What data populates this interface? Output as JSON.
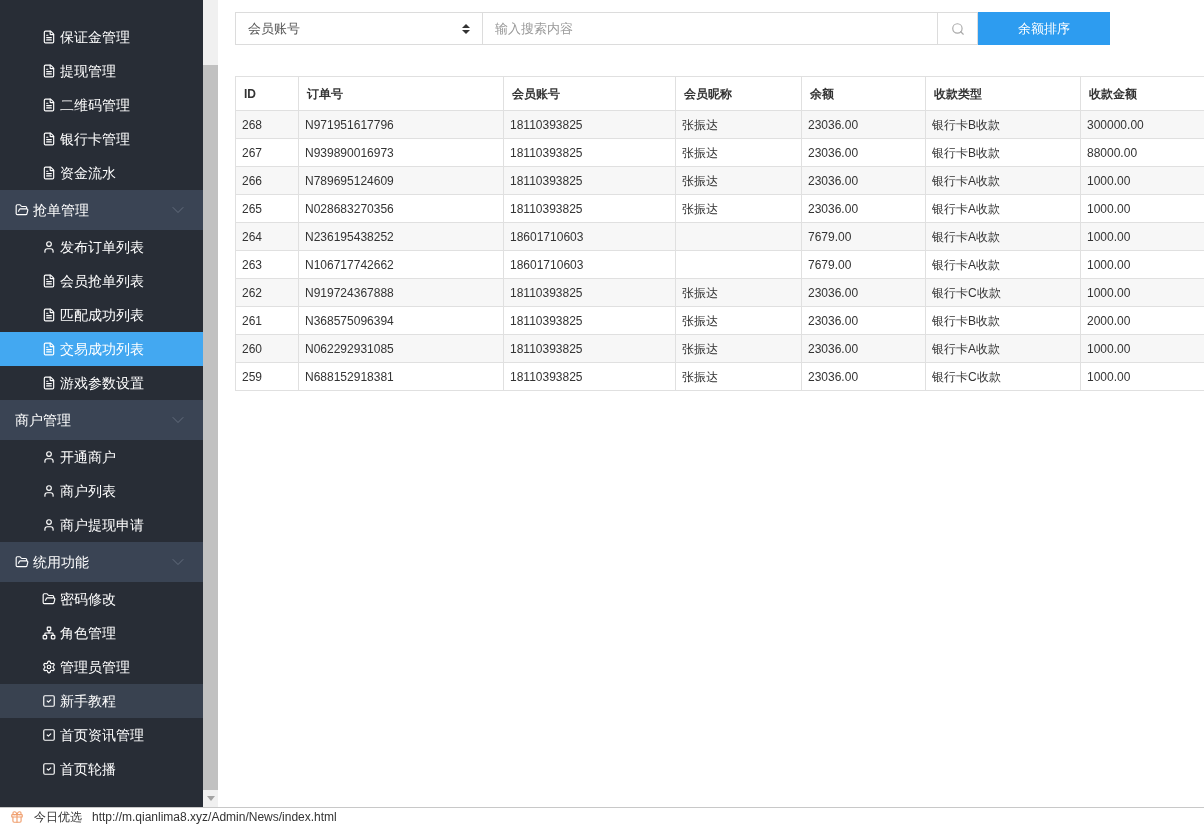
{
  "sidebar": {
    "sections": [
      {
        "items": [
          {
            "label": "保证金管理",
            "selected": false,
            "highlighted": false
          },
          {
            "label": "提现管理",
            "selected": false,
            "highlighted": false
          },
          {
            "label": "二维码管理",
            "selected": false,
            "highlighted": false
          },
          {
            "label": "银行卡管理",
            "selected": false,
            "highlighted": false
          },
          {
            "label": "资金流水",
            "selected": false,
            "highlighted": false
          }
        ]
      },
      {
        "title": "抢单管理",
        "items": [
          {
            "label": "发布订单列表",
            "selected": false,
            "highlighted": false
          },
          {
            "label": "会员抢单列表",
            "selected": false,
            "highlighted": false
          },
          {
            "label": "匹配成功列表",
            "selected": false,
            "highlighted": false
          },
          {
            "label": "交易成功列表",
            "selected": true,
            "highlighted": false
          },
          {
            "label": "游戏参数设置",
            "selected": false,
            "highlighted": false
          }
        ]
      },
      {
        "title": "商户管理",
        "items": [
          {
            "label": "开通商户",
            "selected": false,
            "highlighted": false
          },
          {
            "label": "商户列表",
            "selected": false,
            "highlighted": false
          },
          {
            "label": "商户提现申请",
            "selected": false,
            "highlighted": false
          }
        ]
      },
      {
        "title": "统用功能",
        "items": [
          {
            "label": "密码修改",
            "selected": false,
            "highlighted": false
          },
          {
            "label": "角色管理",
            "selected": false,
            "highlighted": false
          },
          {
            "label": "管理员管理",
            "selected": false,
            "highlighted": false
          },
          {
            "label": "新手教程",
            "selected": false,
            "highlighted": true
          },
          {
            "label": "首页资讯管理",
            "selected": false,
            "highlighted": false
          },
          {
            "label": "首页轮播",
            "selected": false,
            "highlighted": false
          }
        ]
      }
    ]
  },
  "search": {
    "field_select": "会员账号",
    "placeholder": "输入搜索内容",
    "sort_button": "余额排序"
  },
  "table": {
    "columns": [
      "ID",
      "订单号",
      "会员账号",
      "会员昵称",
      "余额",
      "收款类型",
      "收款金额"
    ],
    "rows": [
      [
        "268",
        "N971951617796",
        "18110393825",
        "张振达",
        "23036.00",
        "银行卡B收款",
        "300000.00"
      ],
      [
        "267",
        "N939890016973",
        "18110393825",
        "张振达",
        "23036.00",
        "银行卡B收款",
        "88000.00"
      ],
      [
        "266",
        "N789695124609",
        "18110393825",
        "张振达",
        "23036.00",
        "银行卡A收款",
        "1000.00"
      ],
      [
        "265",
        "N028683270356",
        "18110393825",
        "张振达",
        "23036.00",
        "银行卡A收款",
        "1000.00"
      ],
      [
        "264",
        "N236195438252",
        "18601710603",
        "",
        "7679.00",
        "银行卡A收款",
        "1000.00"
      ],
      [
        "263",
        "N106717742662",
        "18601710603",
        "",
        "7679.00",
        "银行卡A收款",
        "1000.00"
      ],
      [
        "262",
        "N919724367888",
        "18110393825",
        "张振达",
        "23036.00",
        "银行卡C收款",
        "1000.00"
      ],
      [
        "261",
        "N368575096394",
        "18110393825",
        "张振达",
        "23036.00",
        "银行卡B收款",
        "2000.00"
      ],
      [
        "260",
        "N062292931085",
        "18110393825",
        "张振达",
        "23036.00",
        "银行卡A收款",
        "1000.00"
      ],
      [
        "259",
        "N688152918381",
        "18110393825",
        "张振达",
        "23036.00",
        "银行卡C收款",
        "1000.00"
      ]
    ]
  },
  "status_bar": {
    "label": "今日优选",
    "url": "http://m.qianlima8.xyz/Admin/News/index.html"
  }
}
